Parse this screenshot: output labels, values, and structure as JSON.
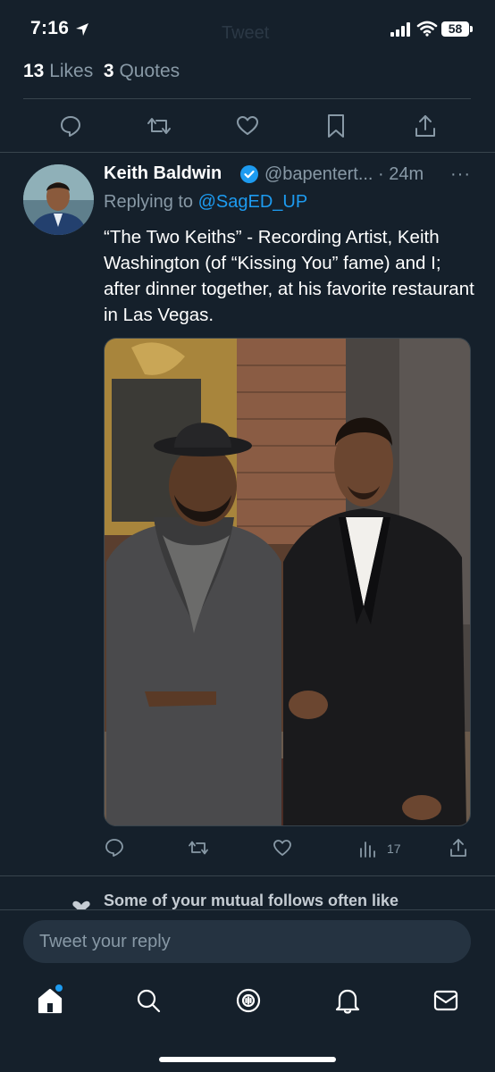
{
  "status_bar": {
    "time": "7:16",
    "battery": "58",
    "background_title": "Tweet"
  },
  "stats": {
    "likes_count": "13",
    "likes_label": "Likes",
    "quotes_count": "3",
    "quotes_label": "Quotes"
  },
  "reply_tweet": {
    "author_name": "Keith Baldwin",
    "handle": "@bapentert...",
    "time_ago": "· 24m",
    "more": "···",
    "replying_prefix": "Replying to",
    "replying_handle": "@SagED_UP",
    "text": "“The Two Keiths” - Recording Artist, Keith Washington (of “Kissing You” fame) and I; after dinner together, at his favorite restaurant in Las Vegas.",
    "views": "17"
  },
  "suggestion": {
    "text": "Some of your mutual follows often like"
  },
  "reply_box": {
    "placeholder": "Tweet your reply"
  },
  "colors": {
    "background": "#15202b",
    "muted": "#8899a6",
    "accent": "#1d9bf0",
    "divider": "#38444d"
  },
  "icons": {
    "main_actions": [
      "reply-icon",
      "retweet-icon",
      "like-icon",
      "bookmark-icon",
      "share-icon"
    ],
    "tweet_actions": [
      "reply-icon",
      "retweet-icon",
      "like-icon",
      "views-icon",
      "share-icon"
    ],
    "nav": [
      "home-icon",
      "search-icon",
      "spaces-icon",
      "notifications-icon",
      "messages-icon"
    ]
  }
}
